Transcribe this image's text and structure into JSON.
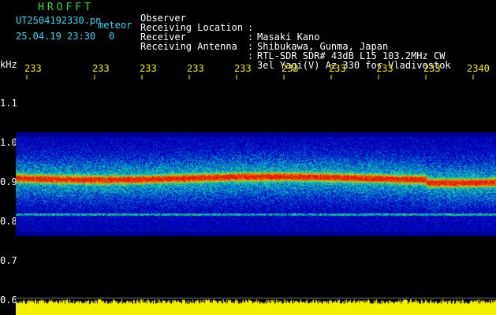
{
  "app": {
    "title": "HROFFT"
  },
  "file": {
    "name": "UT2504192330.pn",
    "mode": "meteor",
    "datetime": "25.04.19 23:30",
    "count": "0"
  },
  "info": [
    {
      "label": "Observer",
      "value": "Masaki Kano"
    },
    {
      "label": "Receiving Location",
      "value": "Shibukawa, Gunma, Japan"
    },
    {
      "label": "Receiver",
      "value": "RTL-SDR SDR# 43dB L15 103.2MHz CW"
    },
    {
      "label": "Receiving Antenna",
      "value": "3el Yagi(V) Az 330 for Vladivostok"
    }
  ],
  "info_separator": ":",
  "axis": {
    "unit": "kHz",
    "y_ticks": [
      "1.1",
      "1.0",
      "0.9",
      "0.8",
      "0.7",
      "0.6"
    ],
    "time_ticks": [
      "233",
      "233",
      "233",
      "233",
      "233",
      "233",
      "233",
      "233",
      "233",
      "2340"
    ]
  },
  "colors": {
    "background": "#000000",
    "title": "#2fdc2f",
    "info": "#37d7f0",
    "ticks": "#f4f000",
    "signal": "#0a2ac8"
  }
}
